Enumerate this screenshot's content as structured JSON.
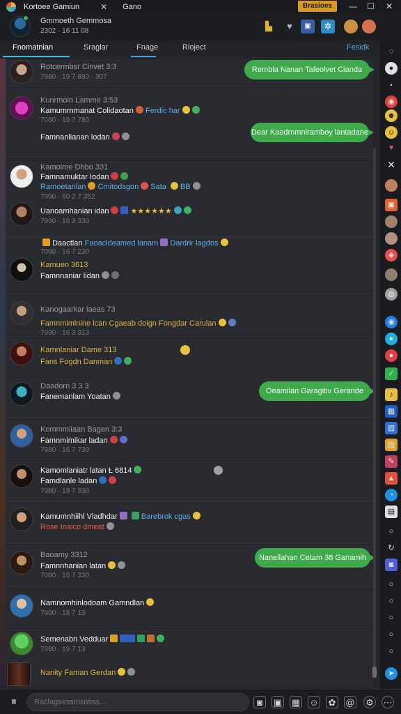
{
  "titlebar": {
    "title": "Kortoee Gamiun",
    "tab2": "Gano",
    "badge": "Brasioes",
    "minimize": "—",
    "maximize": "☐",
    "close": "✕"
  },
  "header": {
    "name": "Gmmoeth Gemmosa",
    "sub": "2302 · 16 11 08"
  },
  "tabs": {
    "items": [
      "Fnomatnian",
      "Sraglar",
      "Fnage",
      "Rloject"
    ],
    "action": "Fesidk"
  },
  "messages": [
    {
      "name": "Rotcermbsr Cinvet 3:3",
      "text": "",
      "time": "7980 · 19 7 880 · 307"
    },
    {
      "name": "Kunrmoin Lamme 3:53",
      "text": "Kamumrnmanat Colidaotan",
      "text2": "Ferdic har",
      "time": "7080 · 19 7 780",
      "text3": "Famnanlianan lodan"
    },
    {
      "name": "Kamoime Dhbo 331",
      "text": "Famnamuktar Iodan",
      "text2": "Ramoetanlan",
      "text3": "Cmitodsgon",
      "text4": "Sata",
      "text5": "BB",
      "time": "7990 · 60 2 7 352"
    },
    {
      "name": "",
      "text": "Uanoamhanian idan",
      "time": "7990 · 16 3 330"
    },
    {
      "name": "",
      "text": "Daactlan",
      "text2": "Faoacldeamed lanam",
      "text3": "Dardrir lagdos",
      "time": "7090 · 16 7 230"
    },
    {
      "name": "Kamuen 3613",
      "text": "Famnnaniar lidan",
      "time": ""
    },
    {
      "name": "Kanogaarkar laeas 73",
      "text": "Famnmimlnine lcan Cgaeab doign Fongdar Carulan",
      "time": "7990 · 16 3 313"
    },
    {
      "name": "Kamnlaniar Dame 313",
      "text": "Fans Fogdn Danman",
      "time": ""
    },
    {
      "name": "Daadorn 3 3 3",
      "text": "Fanemanlam Yoatan",
      "time": ""
    },
    {
      "name": "Kommmiiaan Bagen 3:3",
      "text": "Famnmimikar ladan",
      "time": "7980 · 16 7 730"
    },
    {
      "name": "",
      "text": "Kamomlaniatr latan Ł 6814",
      "text2": "Famdlanle ladan",
      "time": "7980 · 19 7 330"
    },
    {
      "name": "",
      "text": "Kamumnhiihl Vladhdar",
      "text2": "Barebrok cgas",
      "text3": "Rose Inaico dmeat",
      "time": ""
    },
    {
      "name": "Baoamy 3312",
      "text": "Famnnhanian latan",
      "time": "7080 · 16 7 330"
    },
    {
      "name": "",
      "text": "Namnomhinlodoam Gamndlan",
      "time": "7990 · 18 7 13"
    },
    {
      "name": "",
      "text": "Semenabn Vedduar",
      "time": "7980 · 19 7 13"
    },
    {
      "name": "",
      "text": "Nanity Faman Gerdan",
      "time": ""
    }
  ],
  "bubbles": [
    "Rembla Nanan Tafeolvet Cianda",
    "Dear Kaedrnmniramboy lantadane",
    "Oeamlian Garagitiv Gerande",
    "Nanellahan Cetam 36 Ganamih"
  ],
  "composer": {
    "placeholder": "Raclagsessmsntiss..."
  },
  "colors": {
    "accent": "#3cb6d9",
    "bubble": "#3fa94c",
    "badge": "#d89a22"
  }
}
